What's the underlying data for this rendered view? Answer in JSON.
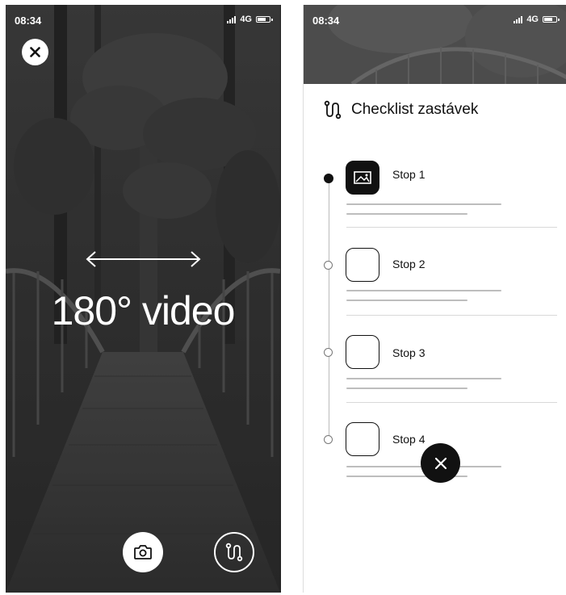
{
  "left_screen": {
    "status": {
      "time": "08:34",
      "network": "4G"
    },
    "title": "180° video",
    "icons": {
      "close": "close-icon",
      "arrow": "double-arrow-icon",
      "camera": "camera-icon",
      "route": "route-icon"
    }
  },
  "right_screen": {
    "status": {
      "time": "08:34",
      "network": "4G"
    },
    "title": "Checklist zastávek",
    "stops": [
      {
        "label": "Stop 1",
        "active": true
      },
      {
        "label": "Stop 2",
        "active": false
      },
      {
        "label": "Stop 3",
        "active": false
      },
      {
        "label": "Stop 4",
        "active": false
      }
    ]
  },
  "colors": {
    "accent": "#111111",
    "overlay": "#3a3a3a",
    "placeholder_line": "#bdbdbd"
  }
}
